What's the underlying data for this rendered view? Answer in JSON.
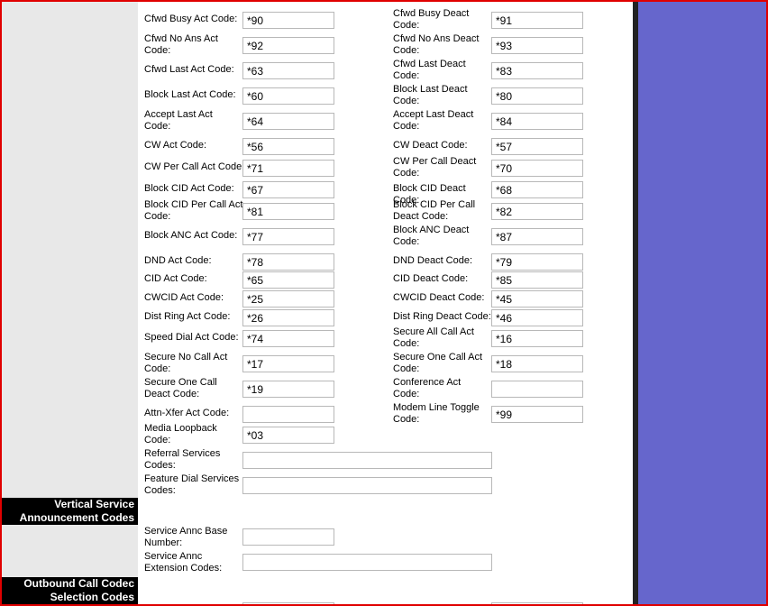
{
  "sections": {
    "vsac_line1": "Vertical Service",
    "vsac_line2": "Announcement Codes",
    "ocs_line1": "Outbound Call Codec",
    "ocs_line2": "Selection Codes"
  },
  "rows": [
    {
      "l1": "Cfwd Busy Act Code:",
      "l2": "",
      "v1": "*90",
      "r1": "Cfwd Busy Deact",
      "r2": "Code:",
      "v2": "*91"
    },
    {
      "l1": "Cfwd No Ans Act",
      "l2": "Code:",
      "v1": "*92",
      "r1": "Cfwd No Ans Deact",
      "r2": "Code:",
      "v2": "*93"
    },
    {
      "l1": "Cfwd Last Act Code:",
      "l2": "",
      "v1": "*63",
      "r1": "Cfwd Last Deact",
      "r2": "Code:",
      "v2": "*83"
    },
    {
      "l1": "Block Last Act Code:",
      "l2": "",
      "v1": "*60",
      "r1": "Block Last Deact",
      "r2": "Code:",
      "v2": "*80"
    },
    {
      "l1": "Accept Last Act",
      "l2": "Code:",
      "v1": "*64",
      "r1": "Accept Last Deact",
      "r2": "Code:",
      "v2": "*84"
    },
    {
      "l1": "CW Act Code:",
      "l2": "",
      "v1": "*56",
      "r1": "CW Deact Code:",
      "r2": "",
      "v2": "*57"
    },
    {
      "l1": "CW Per Call Act Code:",
      "l2": "",
      "v1": "*71",
      "r1": "CW Per Call Deact",
      "r2": "Code:",
      "v2": "*70"
    },
    {
      "l1": "Block CID Act Code:",
      "l2": "",
      "v1": "*67",
      "r1": "Block CID Deact Code:",
      "r2": "",
      "v2": "*68"
    },
    {
      "l1": "Block CID Per Call Act",
      "l2": "Code:",
      "v1": "*81",
      "r1": "Block CID Per Call",
      "r2": "Deact Code:",
      "v2": "*82"
    },
    {
      "l1": "Block ANC Act Code:",
      "l2": "",
      "v1": "*77",
      "r1": "Block ANC Deact",
      "r2": "Code:",
      "v2": "*87"
    },
    {
      "l1": "DND Act Code:",
      "l2": "",
      "v1": "*78",
      "r1": "DND Deact Code:",
      "r2": "",
      "v2": "*79"
    },
    {
      "l1": "CID Act Code:",
      "l2": "",
      "v1": "*65",
      "r1": "CID Deact Code:",
      "r2": "",
      "v2": "*85"
    },
    {
      "l1": "CWCID Act Code:",
      "l2": "",
      "v1": "*25",
      "r1": "CWCID Deact Code:",
      "r2": "",
      "v2": "*45"
    },
    {
      "l1": "Dist Ring Act Code:",
      "l2": "",
      "v1": "*26",
      "r1": "Dist Ring Deact Code:",
      "r2": "",
      "v2": "*46"
    },
    {
      "l1": "Speed Dial Act Code:",
      "l2": "",
      "v1": "*74",
      "r1": "Secure All Call Act",
      "r2": "Code:",
      "v2": "*16"
    },
    {
      "l1": "Secure No Call Act",
      "l2": "Code:",
      "v1": "*17",
      "r1": "Secure One Call Act",
      "r2": "Code:",
      "v2": "*18"
    },
    {
      "l1": "Secure One Call",
      "l2": "Deact Code:",
      "v1": "*19",
      "r1": "Conference Act",
      "r2": "Code:",
      "v2": ""
    },
    {
      "l1": "Attn-Xfer Act Code:",
      "l2": "",
      "v1": "",
      "r1": "Modem Line Toggle",
      "r2": "Code:",
      "v2": "*99"
    }
  ],
  "media_loopback": {
    "l1": "Media Loopback",
    "l2": "Code:",
    "value": "*03"
  },
  "referral": {
    "l1": "Referral Services",
    "l2": "Codes:",
    "value": ""
  },
  "feature_dial": {
    "l1": "Feature Dial Services",
    "l2": "Codes:",
    "value": ""
  },
  "annc_base": {
    "l1": "Service Annc Base",
    "l2": "Number:",
    "value": ""
  },
  "annc_ext": {
    "l1": "Service Annc",
    "l2": "Extension Codes:",
    "value": ""
  }
}
